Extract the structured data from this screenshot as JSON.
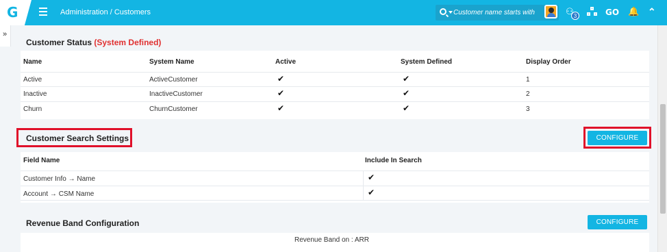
{
  "app": {
    "logo_letter": "G"
  },
  "header": {
    "breadcrumb": "Administration / Customers",
    "search_placeholder": "Customer name starts with",
    "notification_badge": "3",
    "go_label": "GO"
  },
  "status_section": {
    "title": "Customer Status",
    "title_suffix": "(System Defined)",
    "columns": [
      "Name",
      "System Name",
      "Active",
      "System Defined",
      "Display Order"
    ],
    "rows": [
      {
        "name": "Active",
        "system_name": "ActiveCustomer",
        "active": "✔",
        "system_defined": "✔",
        "order": "1"
      },
      {
        "name": "Inactive",
        "system_name": "InactiveCustomer",
        "active": "✔",
        "system_defined": "✔",
        "order": "2"
      },
      {
        "name": "Churn",
        "system_name": "ChurnCustomer",
        "active": "✔",
        "system_defined": "✔",
        "order": "3"
      }
    ]
  },
  "search_section": {
    "title": "Customer Search Settings",
    "configure_label": "CONFIGURE",
    "columns": [
      "Field Name",
      "Include In Search"
    ],
    "rows": [
      {
        "field": "Customer Info → Name",
        "included": "✔"
      },
      {
        "field": "Account → CSM Name",
        "included": "✔"
      }
    ]
  },
  "revenue_section": {
    "title": "Revenue Band Configuration",
    "configure_label": "CONFIGURE",
    "band_text": "Revenue Band on : ARR"
  },
  "colors": {
    "accent": "#13b5e3",
    "highlight": "#e0102a",
    "system_defined": "#e03131"
  },
  "icons": [
    "menu-icon",
    "search-icon",
    "users-icon",
    "org-chart-icon",
    "bell-icon",
    "chevron-up-icon",
    "expand-icon"
  ]
}
